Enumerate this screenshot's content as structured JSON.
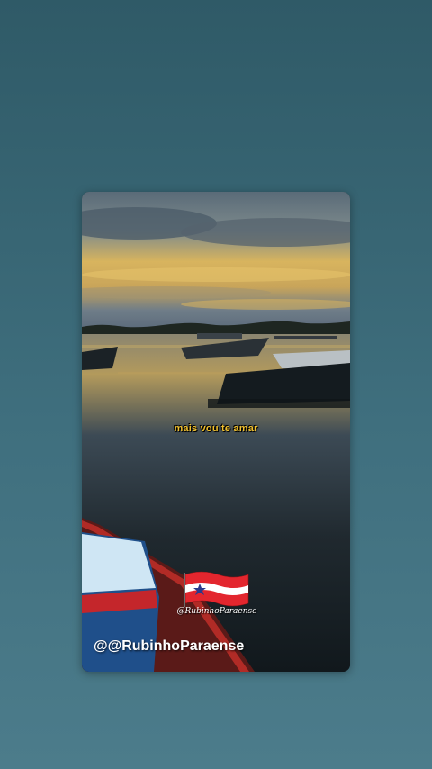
{
  "story": {
    "caption": "mais vou te amar",
    "watermark": "@RubinhoParaense",
    "username": "@@RubinhoParaense"
  },
  "colors": {
    "background": "#3f6f7e",
    "caption": "#f2c12e",
    "flag_red": "#e3262e",
    "flag_star": "#2a3a8c"
  },
  "icons": {
    "flag": "para-state-flag-icon"
  }
}
